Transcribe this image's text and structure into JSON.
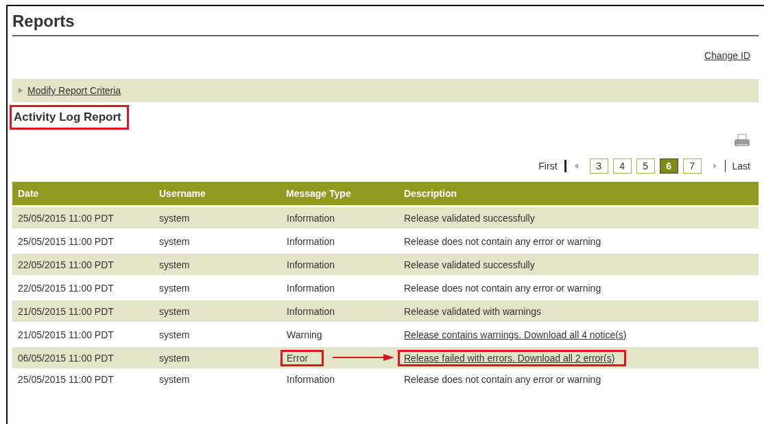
{
  "page": {
    "title": "Reports",
    "change_id": "Change ID"
  },
  "criteria": {
    "label": "Modify Report Criteria",
    "expanded": false
  },
  "report": {
    "title": "Activity Log Report",
    "annotated": true
  },
  "pagination": {
    "first": "First",
    "last": "Last",
    "pages": [
      {
        "label": "3",
        "selected": false
      },
      {
        "label": "4",
        "selected": false
      },
      {
        "label": "5",
        "selected": false
      },
      {
        "label": "6",
        "selected": true
      },
      {
        "label": "7",
        "selected": false
      }
    ]
  },
  "table": {
    "columns": [
      "Date",
      "Username",
      "Message Type",
      "Description"
    ],
    "rows": [
      {
        "date": "25/05/2015 11:00 PDT",
        "username": "system",
        "type": "Information",
        "description": "Release validated successfully",
        "link": false,
        "annotated": false
      },
      {
        "date": "25/05/2015 11:00 PDT",
        "username": "system",
        "type": "Information",
        "description": "Release does not contain any error or warning",
        "link": false,
        "annotated": false
      },
      {
        "date": "22/05/2015 11:00 PDT",
        "username": "system",
        "type": "Information",
        "description": "Release validated successfully",
        "link": false,
        "annotated": false
      },
      {
        "date": "22/05/2015 11:00 PDT",
        "username": "system",
        "type": "Information",
        "description": "Release does not contain any error or warning",
        "link": false,
        "annotated": false
      },
      {
        "date": "21/05/2015 11:00 PDT",
        "username": "system",
        "type": "Information",
        "description": "Release validated with warnings",
        "link": false,
        "annotated": false
      },
      {
        "date": "21/05/2015 11:00 PDT",
        "username": "system",
        "type": "Warning",
        "description": "Release contains warnings. Download all 4 notice(s)",
        "link": true,
        "annotated": false
      },
      {
        "date": "06/05/2015 11:00 PDT",
        "username": "system",
        "type": "Error",
        "description": "Release failed with errors. Download all 2 error(s)",
        "link": true,
        "annotated": true
      },
      {
        "date": "25/05/2015 11:00 PDT",
        "username": "system",
        "type": "Information",
        "description": "Release does not contain any error or warning",
        "link": false,
        "annotated": false
      }
    ]
  }
}
